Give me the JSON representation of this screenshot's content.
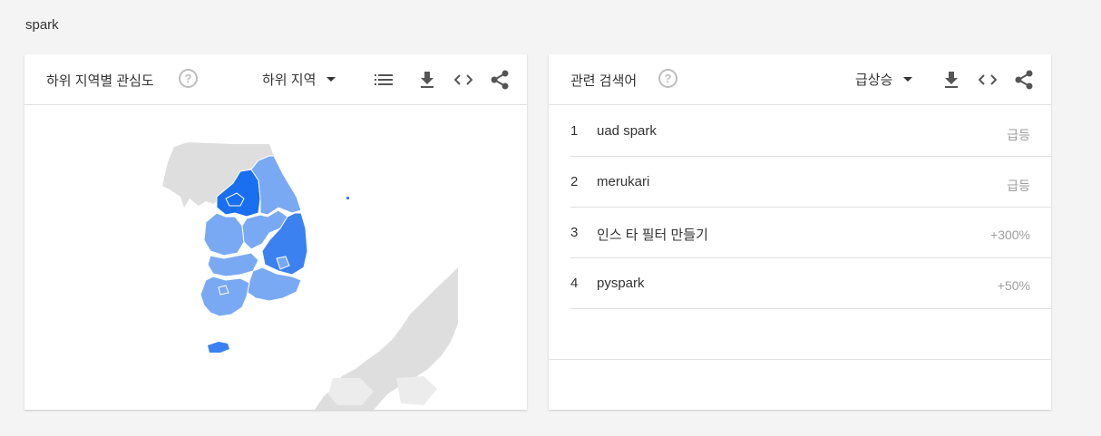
{
  "search_term": "spark",
  "left_card": {
    "title": "하위 지역별 관심도",
    "help": "?",
    "dropdown_label": "하위 지역",
    "icons": [
      "list-icon",
      "download-icon",
      "embed-icon",
      "share-icon"
    ]
  },
  "right_card": {
    "title": "관련 검색어",
    "help": "?",
    "dropdown_label": "급상승",
    "icons": [
      "download-icon",
      "embed-icon",
      "share-icon"
    ],
    "rows": [
      {
        "rank": "1",
        "term": "uad spark",
        "value": "급등"
      },
      {
        "rank": "2",
        "term": "merukari",
        "value": "급등"
      },
      {
        "rank": "3",
        "term": "인스 타 필터 만들기",
        "value": "+300%"
      },
      {
        "rank": "4",
        "term": "pyspark",
        "value": "+50%"
      }
    ]
  },
  "colors": {
    "region_dark": "#1a6ff0",
    "region_mid": "#3b82f0",
    "region_light": "#7aa9f4",
    "land_gray": "#dedede"
  }
}
